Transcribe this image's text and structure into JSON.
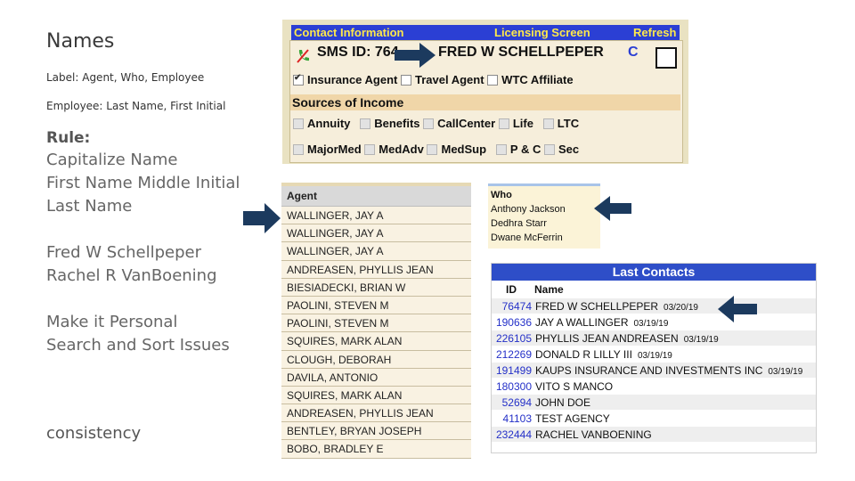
{
  "left": {
    "title": "Names",
    "note1": "Label: Agent, Who, Employee",
    "note2": "Employee: Last Name, First Initial",
    "rule_heading": "Rule:",
    "rule_lines": [
      "Capitalize Name",
      "First Name Middle Initial",
      "Last Name"
    ],
    "examples": [
      "Fred W Schellpeper",
      "Rachel R VanBoening"
    ],
    "personal": [
      "Make it Personal",
      "Search and Sort Issues"
    ],
    "footer": "consistency"
  },
  "contact": {
    "bar_title": "Contact Information",
    "bar_center": "Licensing Screen",
    "bar_refresh": "Refresh",
    "sms_label": "SMS ID: 764",
    "name": "FRED W SCHELLPEPER",
    "code": "C",
    "flags": [
      {
        "label": "Insurance Agent",
        "checked": true
      },
      {
        "label": "Travel Agent",
        "checked": false
      },
      {
        "label": "WTC Affiliate",
        "checked": false
      }
    ],
    "sources_label": "Sources of Income",
    "income_row1": [
      "Annuity",
      "Benefits",
      "CallCenter",
      "Life",
      "LTC"
    ],
    "income_row2": [
      "MajorMed",
      "MedAdv",
      "MedSup",
      "P & C",
      "Sec"
    ]
  },
  "agent_table": {
    "header": "Agent",
    "rows": [
      "WALLINGER, JAY A",
      "WALLINGER, JAY A",
      "WALLINGER, JAY A",
      "ANDREASEN, PHYLLIS JEAN",
      "BIESIADECKI, BRIAN W",
      "PAOLINI, STEVEN M",
      "PAOLINI, STEVEN M",
      "SQUIRES, MARK ALAN",
      "CLOUGH, DEBORAH",
      "DAVILA, ANTONIO",
      "SQUIRES, MARK ALAN",
      "ANDREASEN, PHYLLIS JEAN",
      "BENTLEY, BRYAN JOSEPH",
      "BOBO, BRADLEY E"
    ]
  },
  "who": {
    "header": "Who",
    "rows": [
      "Anthony Jackson",
      "Dedhra Starr",
      "Dwane McFerrin"
    ]
  },
  "last_contacts": {
    "title": "Last Contacts",
    "col_id": "ID",
    "col_name": "Name",
    "rows": [
      {
        "id": "76474",
        "name": "FRED W SCHELLPEPER",
        "date": "03/20/19"
      },
      {
        "id": "190636",
        "name": "JAY A WALLINGER",
        "date": "03/19/19"
      },
      {
        "id": "226105",
        "name": "PHYLLIS JEAN ANDREASEN",
        "date": "03/19/19"
      },
      {
        "id": "212269",
        "name": "DONALD R LILLY III",
        "date": "03/19/19"
      },
      {
        "id": "191499",
        "name": "KAUPS INSURANCE AND INVESTMENTS INC",
        "date": "03/19/19"
      },
      {
        "id": "180300",
        "name": "VITO S MANCO",
        "date": ""
      },
      {
        "id": "52694",
        "name": "JOHN DOE",
        "date": ""
      },
      {
        "id": "41103",
        "name": "TEST AGENCY",
        "date": ""
      },
      {
        "id": "232444",
        "name": "RACHEL VANBOENING",
        "date": ""
      }
    ]
  },
  "colors": {
    "bar_blue": "#2b3fd4",
    "bar_text": "#ffe94a",
    "arrow_navy": "#1c3a5e",
    "id_link": "#2430c8"
  }
}
